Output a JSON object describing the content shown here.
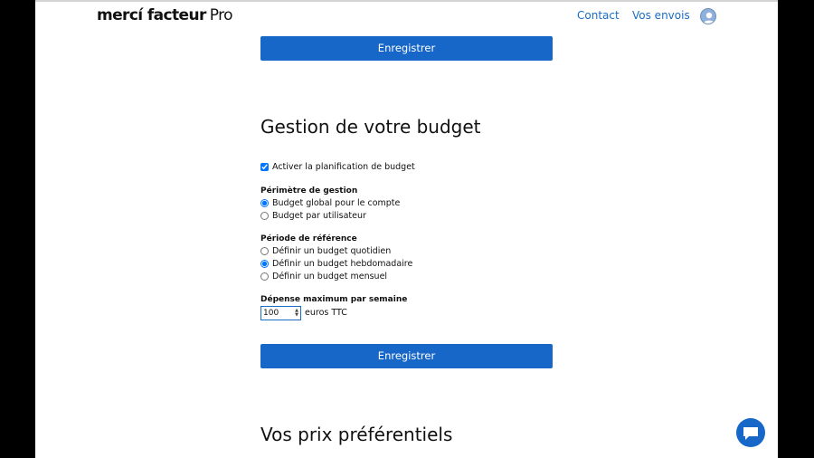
{
  "header": {
    "logo_main": "mercí facteur",
    "logo_pro": "Pro",
    "nav": [
      "Contact",
      "Vos envois"
    ],
    "avatar_icon": "user-avatar-icon"
  },
  "top_button_label": "Enregistrer",
  "budget": {
    "title": "Gestion de votre budget",
    "enable_label": "Activer la planification de budget",
    "enable_checked": true,
    "scope_heading": "Périmètre de gestion",
    "scope_options": [
      "Budget global pour le compte",
      "Budget par utilisateur"
    ],
    "scope_selected": 0,
    "period_heading": "Période de référence",
    "period_options": [
      "Définir un budget quotidien",
      "Définir un budget hebdomadaire",
      "Définir un budget mensuel"
    ],
    "period_selected": 1,
    "max_heading": "Dépense maximum par semaine",
    "max_value": "100",
    "max_unit": "euros TTC",
    "save_label": "Enregistrer"
  },
  "prices": {
    "title": "Vos prix préférentiels"
  },
  "colors": {
    "accent": "#1767c8",
    "link": "#1a6dc4"
  },
  "chat_icon": "chat-bubble-icon"
}
